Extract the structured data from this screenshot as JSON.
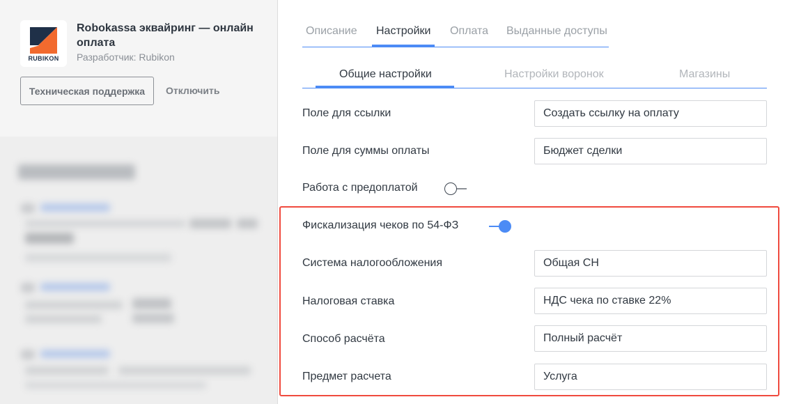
{
  "app": {
    "logo_text": "RUBIKON",
    "title": "Robokassa эквайринг — онлайн оплата",
    "developer": "Разработчик: Rubikon",
    "support_button": "Техническая поддержка",
    "disable_button": "Отключить"
  },
  "tabs": [
    {
      "label": "Описание",
      "active": false
    },
    {
      "label": "Настройки",
      "active": true
    },
    {
      "label": "Оплата",
      "active": false
    },
    {
      "label": "Выданные доступы",
      "active": false
    }
  ],
  "subtabs": [
    {
      "label": "Общие настройки",
      "active": true
    },
    {
      "label": "Настройки воронок",
      "active": false
    },
    {
      "label": "Магазины",
      "active": false
    }
  ],
  "settings": {
    "link_field": {
      "label": "Поле для ссылки",
      "value": "Создать ссылку на оплату"
    },
    "amount_field": {
      "label": "Поле для суммы оплаты",
      "value": "Бюджет сделки"
    },
    "prepayment": {
      "label": "Работа с предоплатой",
      "enabled": false
    },
    "fiscalization": {
      "label": "Фискализация чеков по 54-ФЗ",
      "enabled": true
    },
    "tax_system": {
      "label": "Система налогообложения",
      "value": "Общая СН"
    },
    "tax_rate": {
      "label": "Налоговая ставка",
      "value": "НДС чека по ставке 22%"
    },
    "payment_method": {
      "label": "Способ расчёта",
      "value": "Полный расчёт"
    },
    "payment_subject": {
      "label": "Предмет расчета",
      "value": "Услуга"
    }
  },
  "colors": {
    "accent": "#4c8bf5",
    "highlight": "#f04a3e",
    "logo_dark": "#1f3048",
    "logo_orange": "#f26a2e"
  }
}
